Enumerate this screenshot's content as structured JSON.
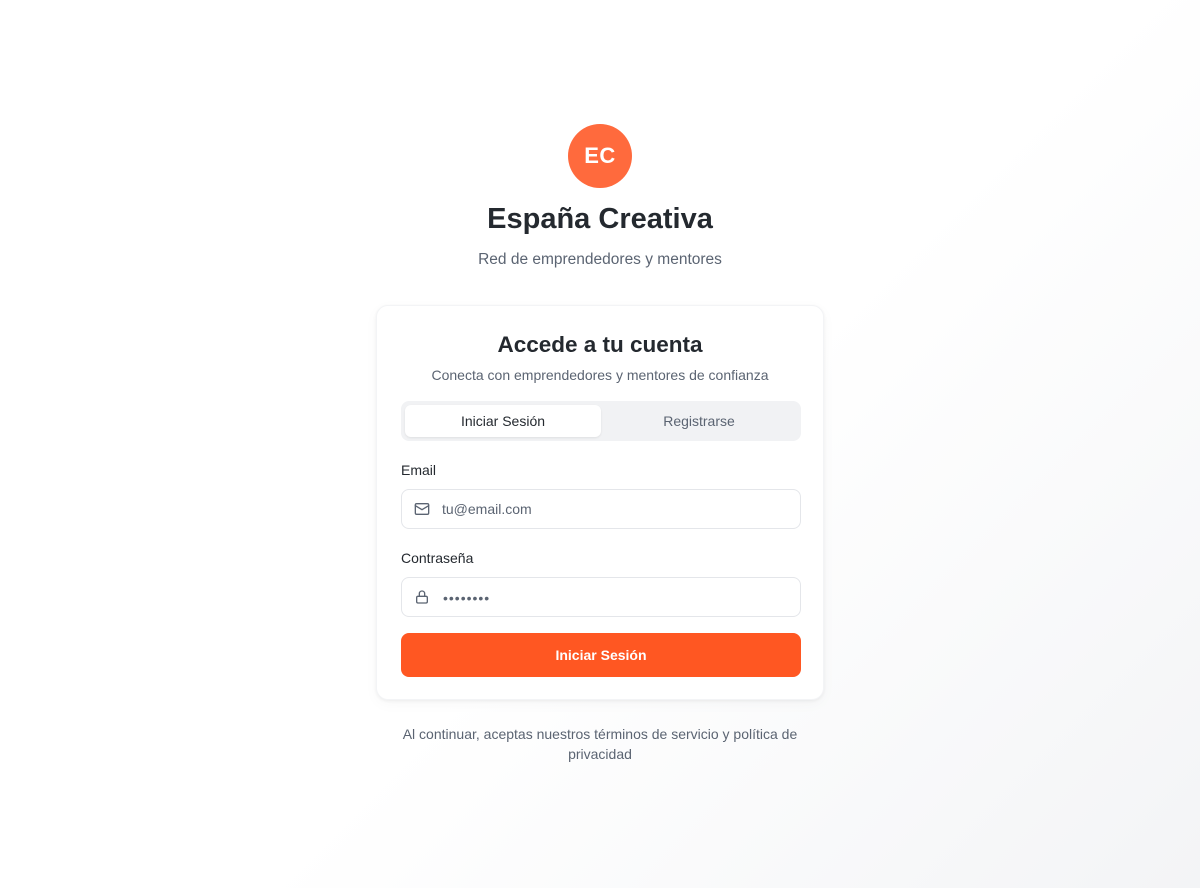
{
  "brand": {
    "initials": "EC",
    "title": "España Creativa",
    "subtitle": "Red de emprendedores y mentores",
    "accent_color": "#ff6a3d"
  },
  "card": {
    "title": "Accede a tu cuenta",
    "subtitle": "Conecta con emprendedores y mentores de confianza",
    "tabs": [
      {
        "label": "Iniciar Sesión",
        "active": true
      },
      {
        "label": "Registrarse",
        "active": false
      }
    ],
    "email": {
      "label": "Email",
      "placeholder": "tu@email.com",
      "icon": "mail-icon"
    },
    "password": {
      "label": "Contraseña",
      "masked_value": "••••••••",
      "icon": "lock-icon"
    },
    "submit_label": "Iniciar Sesión",
    "submit_color": "#ff5722"
  },
  "footer": {
    "note": "Al continuar, aceptas nuestros términos de servicio y política de privacidad"
  }
}
